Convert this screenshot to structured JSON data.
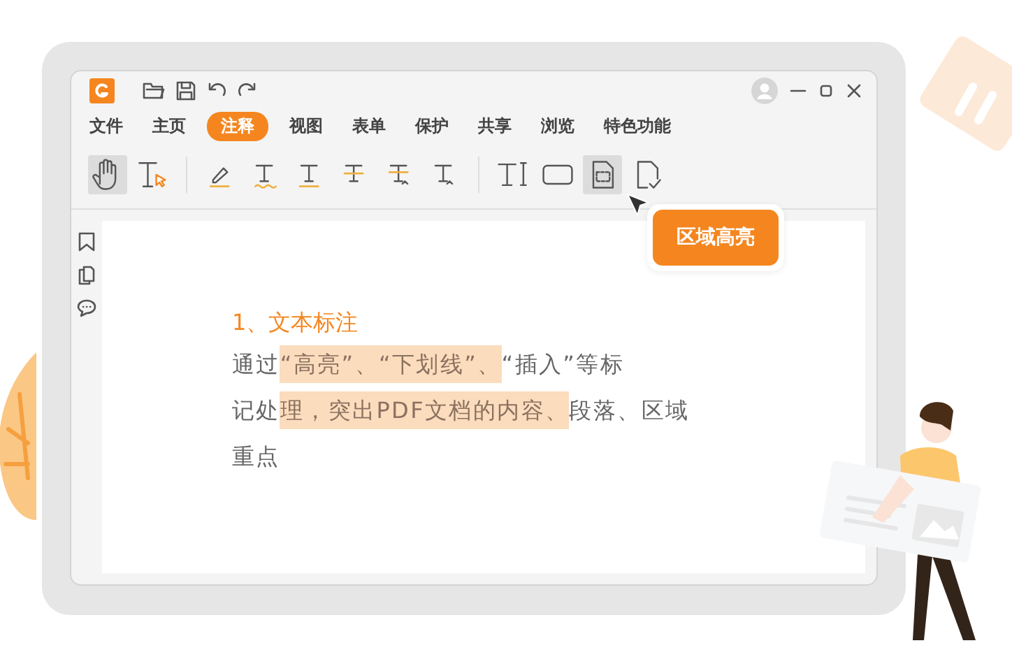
{
  "menu": [
    {
      "label": "文件",
      "selected": false
    },
    {
      "label": "主页",
      "selected": false
    },
    {
      "label": "注释",
      "selected": true
    },
    {
      "label": "视图",
      "selected": false
    },
    {
      "label": "表单",
      "selected": false
    },
    {
      "label": "保护",
      "selected": false
    },
    {
      "label": "共享",
      "selected": false
    },
    {
      "label": "浏览",
      "selected": false
    },
    {
      "label": "特色功能",
      "selected": false
    }
  ],
  "tools": [
    {
      "kind": "hand",
      "selected": true
    },
    {
      "kind": "select-text",
      "selected": false
    },
    {
      "kind": "highlight",
      "selected": false
    },
    {
      "kind": "squiggly",
      "selected": false
    },
    {
      "kind": "underline",
      "selected": false
    },
    {
      "kind": "strikeout",
      "selected": false
    },
    {
      "kind": "replace",
      "selected": false
    },
    {
      "kind": "insert",
      "selected": false
    },
    {
      "kind": "textbox",
      "selected": false
    },
    {
      "kind": "rectangle",
      "selected": false
    },
    {
      "kind": "area-highlight",
      "selected": true
    },
    {
      "kind": "sign",
      "selected": false
    }
  ],
  "tooltip": {
    "label": "区域高亮"
  },
  "document": {
    "heading": "1、文本标注",
    "lines": [
      [
        {
          "text": "通过",
          "highlighted": false
        },
        {
          "text": "“高亮”、“下划线”、",
          "highlighted": true
        },
        {
          "text": "“插入”等标",
          "highlighted": false
        }
      ],
      [
        {
          "text": "记处",
          "highlighted": false
        },
        {
          "text": "理，突出PDF文档的内容、",
          "highlighted": true
        },
        {
          "text": "段落、区域",
          "highlighted": false
        }
      ],
      [
        {
          "text": "重点",
          "highlighted": false
        }
      ]
    ]
  }
}
